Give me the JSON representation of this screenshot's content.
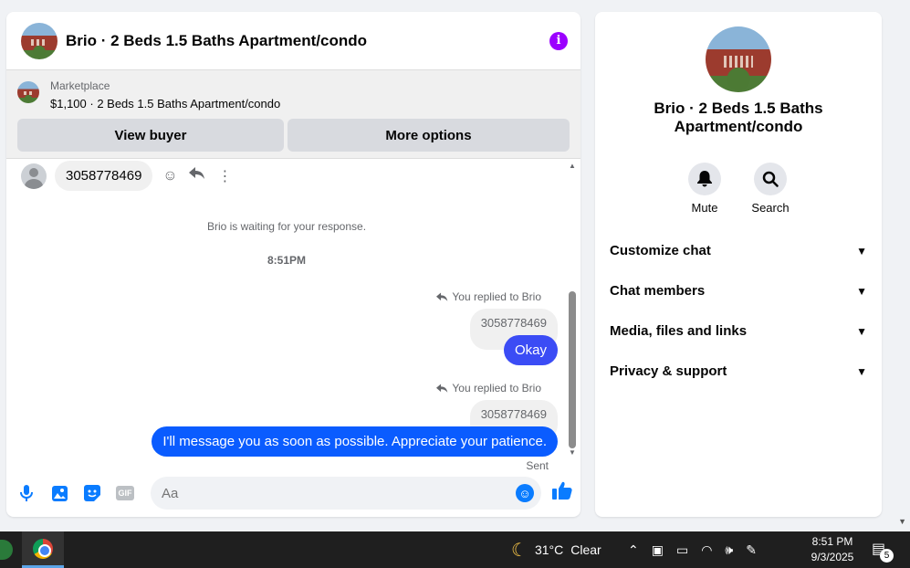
{
  "chat": {
    "title": "Brio · 2 Beds 1.5 Baths Apartment/condo",
    "info_glyph": "i",
    "marketplace": {
      "label": "Marketplace",
      "listing": "$1,100 · 2 Beds 1.5 Baths Apartment/condo",
      "view_buyer_label": "View buyer",
      "more_options_label": "More options"
    },
    "messages": {
      "incoming_text": "3058778469",
      "waiting_note": "Brio is waiting for your response.",
      "timestamp": "8:51PM",
      "reply1": {
        "label": "You replied to Brio",
        "quoted": "3058778469",
        "text": "Okay"
      },
      "reply2": {
        "label": "You replied to Brio",
        "quoted": "3058778469",
        "text": "I'll message you as soon as possible. Appreciate your patience."
      },
      "sent_status": "Sent"
    },
    "composer": {
      "placeholder": "Aa",
      "gif_label": "GIF"
    }
  },
  "info_panel": {
    "title": "Brio · 2 Beds 1.5 Baths Apartment/condo",
    "actions": [
      {
        "label": "Mute",
        "icon": "bell-icon"
      },
      {
        "label": "Search",
        "icon": "search-icon"
      }
    ],
    "sections": [
      "Customize chat",
      "Chat members",
      "Media, files and links",
      "Privacy & support"
    ]
  },
  "taskbar": {
    "weather_temp": "31°C",
    "weather_desc": "Clear",
    "time": "8:51 PM",
    "date": "9/3/2025",
    "notification_count": "5"
  },
  "colors": {
    "accent": "#0a5cff",
    "info_button": "#9b00ff",
    "okay_bubble": "#3b4cf5"
  }
}
